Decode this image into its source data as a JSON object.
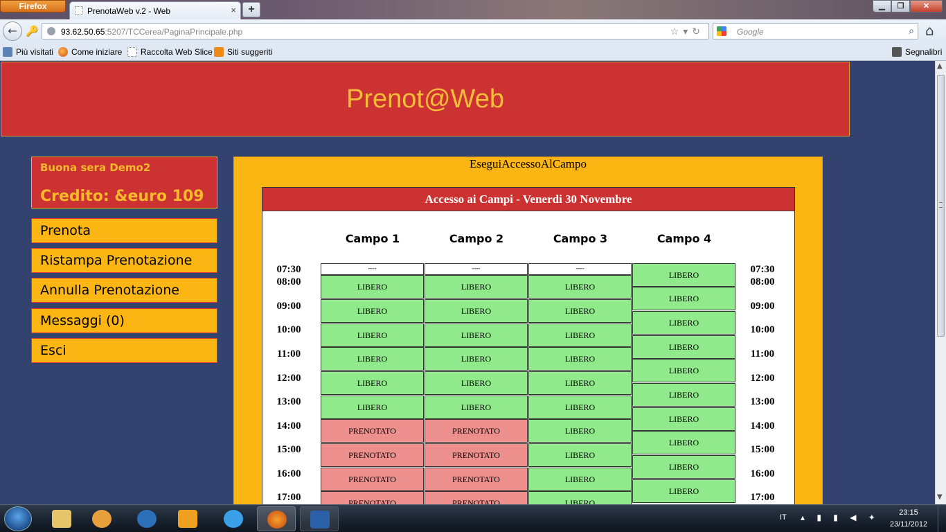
{
  "browser": {
    "firefox_button": "Firefox",
    "tab_title": "PrenotaWeb v.2 - Web",
    "tab_close": "×",
    "new_tab": "+",
    "url_host": "93.62.50.65",
    "url_rest": ":5207/TCCerea/PaginaPrincipale.php",
    "search_placeholder": "Google",
    "window_buttons": {
      "minimize": "▁",
      "maximize": "❐",
      "close": "✕"
    },
    "bookmarks": [
      "Più visitati",
      "Come iniziare",
      "Raccolta Web Slice",
      "Siti suggeriti",
      "Segnalibri"
    ]
  },
  "page": {
    "logo": "Prenot@Web",
    "greeting": "Buona sera Demo2",
    "credit": "Credito: &euro 109",
    "menu": [
      "Prenota",
      "Ristampa Prenotazione",
      "Annulla Prenotazione",
      "Messaggi (0)",
      "Esci"
    ],
    "content_title": "EseguiAccessoAlCampo",
    "panel_title": "Accesso ai Campi - Venerdi 30 Novembre",
    "courts": [
      "Campo 1",
      "Campo 2",
      "Campo 3",
      "Campo 4"
    ],
    "times": [
      "07:30",
      "08:00",
      "09:00",
      "10:00",
      "11:00",
      "12:00",
      "13:00",
      "14:00",
      "15:00",
      "16:00",
      "17:00"
    ],
    "status_labels": {
      "free": "LIBERO",
      "booked": "PRENOTATO",
      "clipped": "----"
    },
    "schedule": {
      "court_1_3_rows": [
        [
          "LIBERO",
          "LIBERO",
          "LIBERO"
        ],
        [
          "LIBERO",
          "LIBERO",
          "LIBERO"
        ],
        [
          "LIBERO",
          "LIBERO",
          "LIBERO"
        ],
        [
          "LIBERO",
          "LIBERO",
          "LIBERO"
        ],
        [
          "LIBERO",
          "LIBERO",
          "LIBERO"
        ],
        [
          "LIBERO",
          "LIBERO",
          "LIBERO"
        ],
        [
          "PRENOTATO",
          "PRENOTATO",
          "LIBERO"
        ],
        [
          "PRENOTATO",
          "PRENOTATO",
          "LIBERO"
        ],
        [
          "PRENOTATO",
          "PRENOTATO",
          "LIBERO"
        ],
        [
          "PRENOTATO",
          "PRENOTATO",
          "LIBERO"
        ]
      ],
      "court_4": [
        "LIBERO",
        "LIBERO",
        "LIBERO",
        "LIBERO",
        "LIBERO",
        "LIBERO",
        "LIBERO",
        "LIBERO",
        "LIBERO",
        "LIBERO"
      ]
    }
  },
  "taskbar": {
    "language": "IT",
    "time": "23:15",
    "date": "23/11/2012"
  },
  "colors": {
    "page_bg": "#34426f",
    "banner_red": "#cd3232",
    "accent_yellow": "#fcb614",
    "free_green": "#90ea8c",
    "booked_red": "#ed8f8c"
  }
}
